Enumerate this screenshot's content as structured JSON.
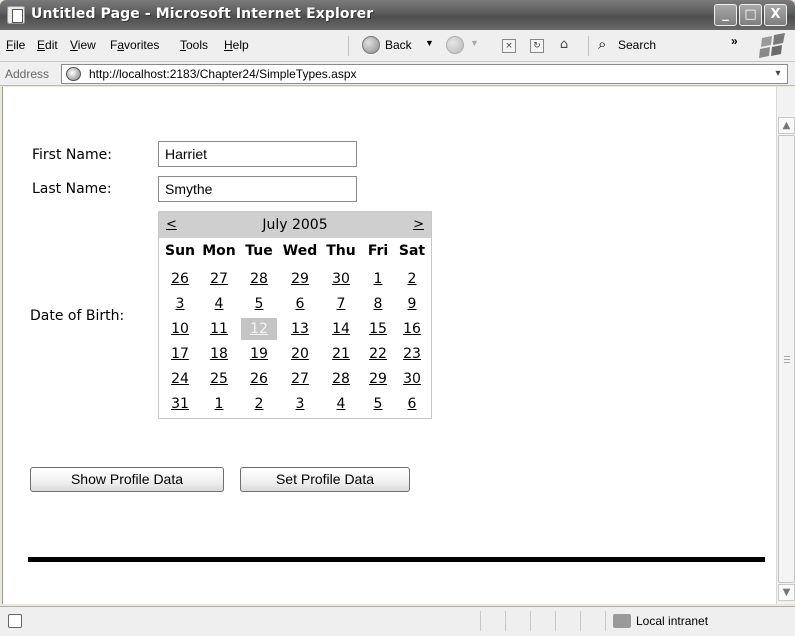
{
  "window": {
    "title": "Untitled Page - Microsoft Internet Explorer",
    "controls": {
      "minimize": "_",
      "maximize": "□",
      "close": "X"
    }
  },
  "menubar": {
    "items": [
      {
        "label": "File",
        "accel": "F",
        "rest": "ile"
      },
      {
        "label": "Edit",
        "accel": "E",
        "rest": "dit"
      },
      {
        "label": "View",
        "accel": "V",
        "rest": "iew"
      },
      {
        "label": "Favorites",
        "pre": "F",
        "accel": "a",
        "rest": "vorites"
      },
      {
        "label": "Tools",
        "accel": "T",
        "rest": "ools"
      },
      {
        "label": "Help",
        "accel": "H",
        "rest": "elp"
      }
    ],
    "back_label": "Back",
    "search_label": "Search",
    "chevron": "»"
  },
  "address": {
    "label": "Address",
    "url": "http://localhost:2183/Chapter24/SimpleTypes.aspx"
  },
  "form": {
    "first_name_label": "First Name:",
    "first_name_value": "Harriet",
    "last_name_label": "Last Name:",
    "last_name_value": "Smythe",
    "dob_label": "Date of Birth:"
  },
  "calendar": {
    "prev": "<",
    "next": ">",
    "month_title": "July 2005",
    "days_of_week": [
      "Sun",
      "Mon",
      "Tue",
      "Wed",
      "Thu",
      "Fri",
      "Sat"
    ],
    "weeks": [
      [
        "26",
        "27",
        "28",
        "29",
        "30",
        "1",
        "2"
      ],
      [
        "3",
        "4",
        "5",
        "6",
        "7",
        "8",
        "9"
      ],
      [
        "10",
        "11",
        "12",
        "13",
        "14",
        "15",
        "16"
      ],
      [
        "17",
        "18",
        "19",
        "20",
        "21",
        "22",
        "23"
      ],
      [
        "24",
        "25",
        "26",
        "27",
        "28",
        "29",
        "30"
      ],
      [
        "31",
        "1",
        "2",
        "3",
        "4",
        "5",
        "6"
      ]
    ],
    "selected_day": "12"
  },
  "buttons": {
    "show_profile": "Show Profile Data",
    "set_profile": "Set Profile Data"
  },
  "statusbar": {
    "zone": "Local intranet"
  },
  "colors": {
    "selected_day_bg": "#c4c4c4",
    "calendar_header_bg": "#cfcfcf"
  }
}
